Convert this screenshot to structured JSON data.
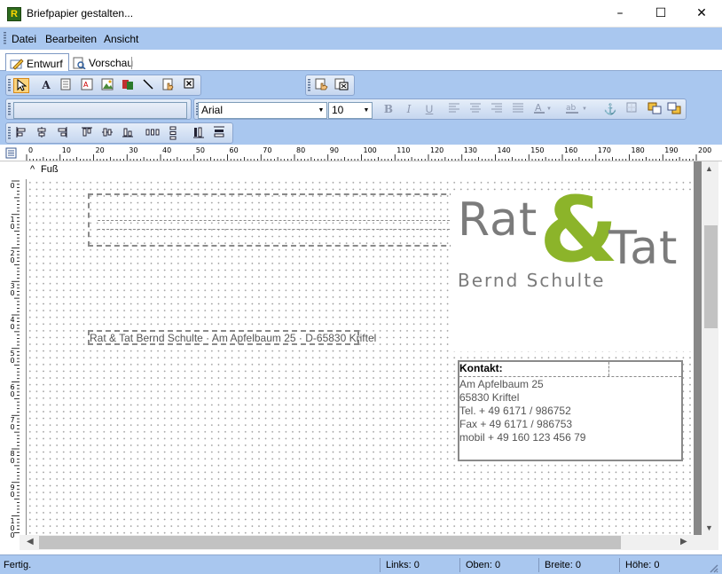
{
  "window": {
    "title": "Briefpapier gestalten...",
    "app_icon_letter": "R",
    "minimize": "–",
    "maximize": "☐",
    "close": "✕"
  },
  "menu": [
    "Datei",
    "Bearbeiten",
    "Ansicht"
  ],
  "tabs": [
    {
      "label": "Entwurf",
      "active": true
    },
    {
      "label": "Vorschau",
      "active": false
    }
  ],
  "toolbar": {
    "font_name": "Arial",
    "font_size": "10",
    "style_selector_value": ""
  },
  "ruler": {
    "top_labels": [
      "0",
      "10",
      "20",
      "30",
      "40",
      "50",
      "60",
      "70",
      "80",
      "90",
      "100",
      "110",
      "120",
      "130",
      "140",
      "150",
      "160",
      "170",
      "180",
      "190",
      "200"
    ],
    "left_labels": [
      "0",
      "10",
      "20",
      "30",
      "40",
      "50",
      "60",
      "70",
      "80",
      "90",
      "100"
    ]
  },
  "section": {
    "label": "Fuß",
    "collapse_glyph": "^"
  },
  "document": {
    "sender_line": "Rat & Tat Bernd Schulte · Am Apfelbaum 25 · D-65830 Kriftel",
    "logo": {
      "word1": "Rat",
      "ampersand": "&",
      "word2": "Tat",
      "subtitle": "Bernd Schulte",
      "gray": "#7b7b7b",
      "green": "#8cb42a"
    },
    "contact": {
      "heading": "Kontakt:",
      "lines": [
        "Am Apfelbaum 25",
        "65830 Kriftel",
        "Tel. + 49 6171 / 986752",
        "Fax + 49 6171 / 986753",
        "mobil + 49 160 123 456 79"
      ]
    }
  },
  "status": {
    "message": "Fertig.",
    "links": "Links: 0",
    "oben": "Oben: 0",
    "breite": "Breite: 0",
    "hoehe": "Höhe: 0"
  },
  "colors": {
    "chrome_blue": "#a9c7ef",
    "selected_tool": "#fbd47d"
  }
}
